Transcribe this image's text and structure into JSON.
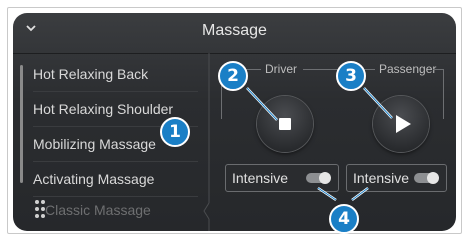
{
  "header": {
    "title": "Massage"
  },
  "list": {
    "items": [
      {
        "label": "Hot Relaxing Back"
      },
      {
        "label": "Hot Relaxing Shoulder"
      },
      {
        "label": "Mobilizing Massage"
      },
      {
        "label": "Activating Massage"
      },
      {
        "label": "Classic Massage"
      }
    ]
  },
  "driver": {
    "label": "Driver",
    "button_icon": "stop-icon",
    "intensive_label": "Intensive",
    "intensive_on": true
  },
  "passenger": {
    "label": "Passenger",
    "button_icon": "play-icon",
    "intensive_label": "Intensive",
    "intensive_on": true
  },
  "callouts": [
    "1",
    "2",
    "3",
    "4"
  ],
  "colors": {
    "callout": "#1a7fc6",
    "screen": "#2b2d30",
    "text": "#d9d9d9"
  }
}
